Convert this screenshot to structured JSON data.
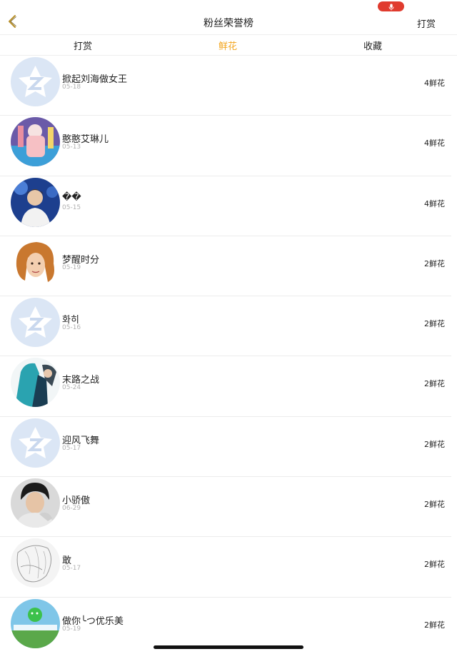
{
  "status": {
    "mic_icon": "microphone-icon",
    "pill_color": "#e03b2e"
  },
  "header": {
    "back_icon": "chevron-left-icon",
    "title": "粉丝荣誉榜",
    "action_label": "打赏"
  },
  "tabs": [
    {
      "label": "打赏",
      "active": false
    },
    {
      "label": "鲜花",
      "active": true
    },
    {
      "label": "收藏",
      "active": false
    }
  ],
  "accent_color": "#f3a51d",
  "fans": [
    {
      "name": "掀起刘海做女王",
      "date": "05-18",
      "amount": "4鲜花",
      "avatar": "default-qq-avatar"
    },
    {
      "name": "憨憨艾琳儿",
      "date": "05-13",
      "amount": "4鲜花",
      "avatar": "cartoon-avatar"
    },
    {
      "name": "��",
      "date": "05-15",
      "amount": "4鲜花",
      "avatar": "photo-avatar"
    },
    {
      "name": "梦醒时分",
      "date": "05-19",
      "amount": "2鲜花",
      "avatar": "illustrated-avatar"
    },
    {
      "name": "화히",
      "date": "05-16",
      "amount": "2鲜花",
      "avatar": "default-qq-avatar"
    },
    {
      "name": "末路之战",
      "date": "05-24",
      "amount": "2鲜花",
      "avatar": "photo-avatar"
    },
    {
      "name": "迎风飞舞",
      "date": "05-17",
      "amount": "2鲜花",
      "avatar": "default-qq-avatar"
    },
    {
      "name": "小骄傲",
      "date": "06-29",
      "amount": "2鲜花",
      "avatar": "photo-avatar"
    },
    {
      "name": "敢",
      "date": "05-17",
      "amount": "2鲜花",
      "avatar": "sketch-avatar"
    },
    {
      "name": "做你╰つ优乐美",
      "date": "05-19",
      "amount": "2鲜花",
      "avatar": "photo-avatar"
    }
  ]
}
